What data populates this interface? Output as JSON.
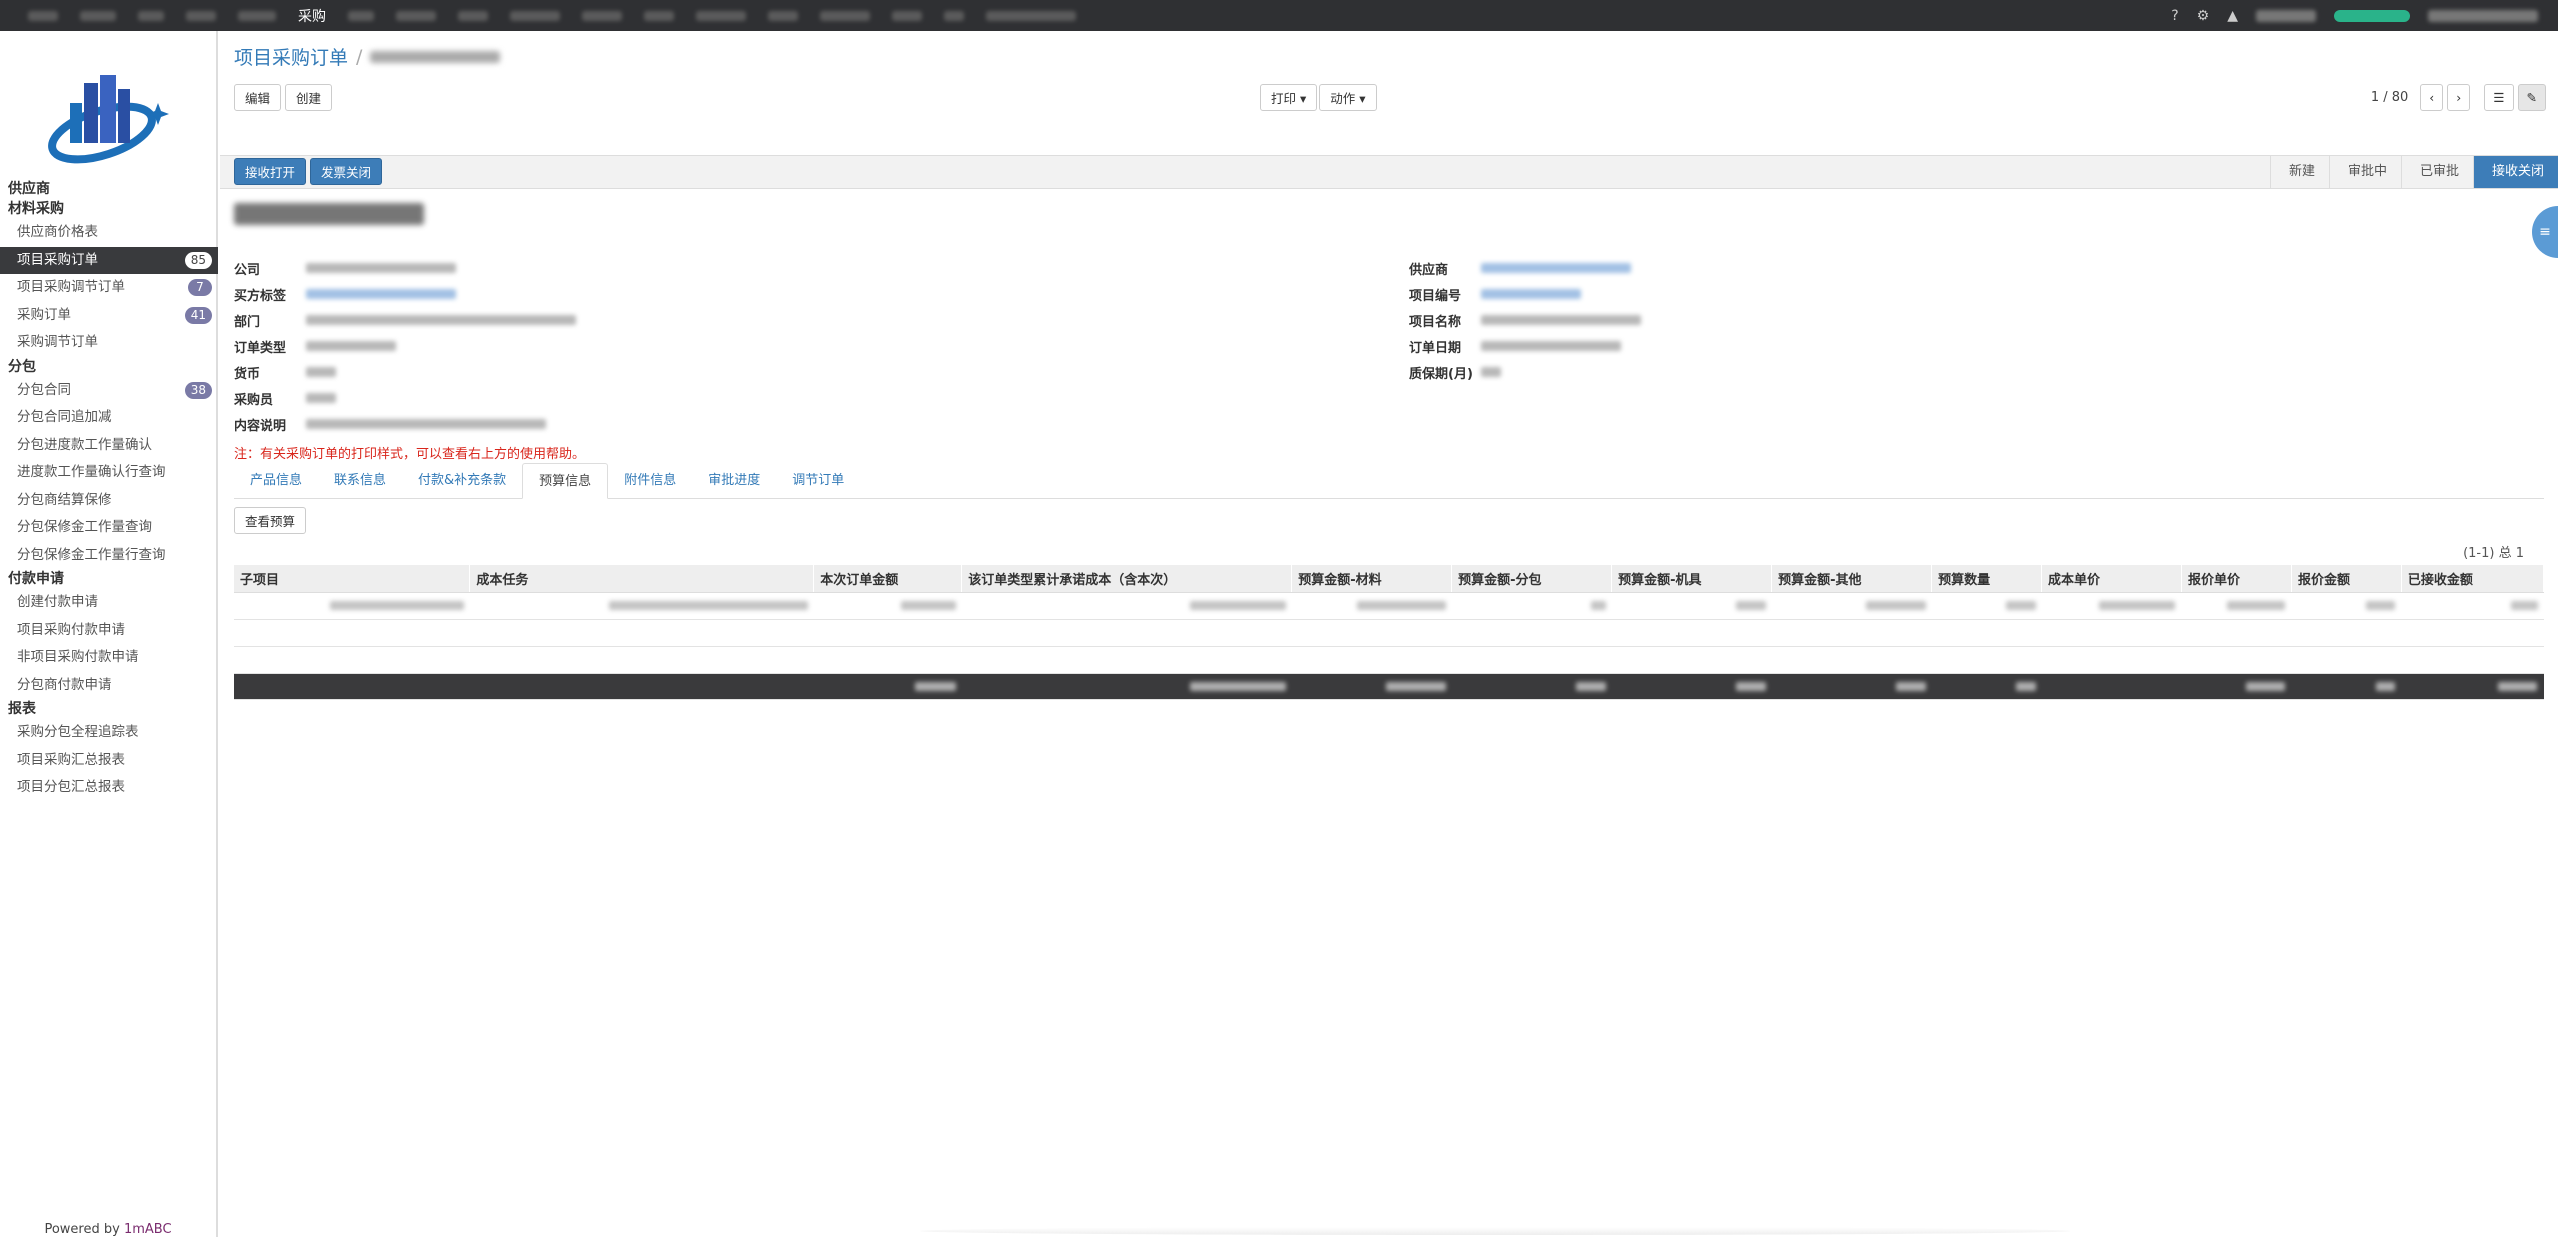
{
  "topbar": {
    "active_menu": "采购",
    "help": "?",
    "gear": "⚙",
    "bell": "🔔"
  },
  "sidebar": {
    "groups": [
      {
        "label": "供应商",
        "items": []
      },
      {
        "label": "材料采购",
        "items": [
          {
            "label": "供应商价格表",
            "badge": ""
          },
          {
            "label": "项目采购订单",
            "badge": "85",
            "active": true
          },
          {
            "label": "项目采购调节订单",
            "badge": "7"
          },
          {
            "label": "采购订单",
            "badge": "41"
          },
          {
            "label": "采购调节订单",
            "badge": ""
          }
        ]
      },
      {
        "label": "分包",
        "items": [
          {
            "label": "分包合同",
            "badge": "38"
          },
          {
            "label": "分包合同追加减",
            "badge": ""
          },
          {
            "label": "分包进度款工作量确认",
            "badge": ""
          },
          {
            "label": "进度款工作量确认行查询",
            "badge": ""
          },
          {
            "label": "分包商结算保修",
            "badge": ""
          },
          {
            "label": "分包保修金工作量查询",
            "badge": ""
          },
          {
            "label": "分包保修金工作量行查询",
            "badge": ""
          }
        ]
      },
      {
        "label": "付款申请",
        "items": [
          {
            "label": "创建付款申请",
            "badge": ""
          },
          {
            "label": "项目采购付款申请",
            "badge": ""
          },
          {
            "label": "非项目采购付款申请",
            "badge": ""
          },
          {
            "label": "分包商付款申请",
            "badge": ""
          }
        ]
      },
      {
        "label": "报表",
        "items": [
          {
            "label": "采购分包全程追踪表",
            "badge": ""
          },
          {
            "label": "项目采购汇总报表",
            "badge": ""
          },
          {
            "label": "项目分包汇总报表",
            "badge": ""
          }
        ]
      }
    ],
    "powered_prefix": "Powered by",
    "powered_brand": "1mABC"
  },
  "breadcrumb": {
    "root": "项目采购订单",
    "sep": "/"
  },
  "toolbar": {
    "edit": "编辑",
    "create": "创建",
    "print": "打印 ▾",
    "action": "动作 ▾",
    "pager": "1 / 80",
    "prev": "‹",
    "next": "›",
    "list_view": "☰",
    "form_view": "✎"
  },
  "statusbar": {
    "receive_open": "接收打开",
    "invoice_close": "发票关闭",
    "stages": [
      "新建",
      "审批中",
      "已审批",
      "接收关闭"
    ],
    "current_stage": "接收关闭"
  },
  "form": {
    "left_labels": [
      "公司",
      "买方标签",
      "部门",
      "订单类型",
      "货币",
      "采购员"
    ],
    "right_labels": [
      "供应商",
      "项目编号",
      "项目名称",
      "订单日期",
      "质保期(月)"
    ],
    "description_label": "内容说明",
    "note": "注：有关采购订单的打印样式，可以查看右上方的使用帮助。"
  },
  "tabs": [
    "产品信息",
    "联系信息",
    "付款&补充条款",
    "预算信息",
    "附件信息",
    "审批进度",
    "调节订单"
  ],
  "active_tab": "预算信息",
  "view_budget": "查看预算",
  "range_info": "(1-1) 总 1",
  "table": {
    "columns": [
      "子项目",
      "成本任务",
      "本次订单金额",
      "该订单类型累计承诺成本（含本次）",
      "预算金额-材料",
      "预算金额-分包",
      "预算金额-机具",
      "预算金额-其他",
      "预算数量",
      "成本单价",
      "报价单价",
      "报价金额",
      "已接收金额"
    ]
  }
}
